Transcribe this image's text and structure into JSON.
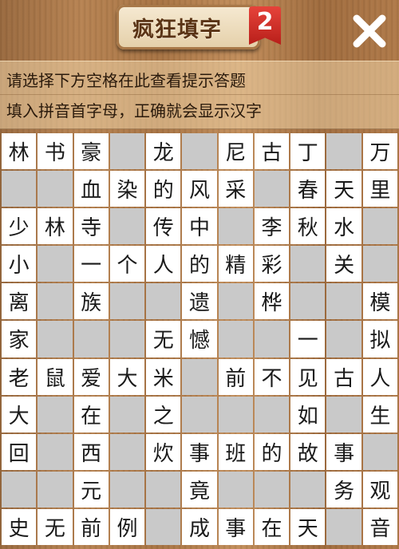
{
  "header": {
    "title": "疯狂填字",
    "badge": "2",
    "close_glyph": "✕"
  },
  "hint": {
    "line1": "请选择下方空格在此查看提示答题",
    "line2": "填入拼音首字母，正确就会显示汉字"
  },
  "colors": {
    "cell_filled": "#ffffff",
    "cell_blocked": "#c9c9c9",
    "badge": "#d63028",
    "title_text": "#5a3416"
  },
  "grid": {
    "rows": 11,
    "cols": 11,
    "block_marker": "#",
    "cells": [
      [
        "林",
        "书",
        "豪",
        "#",
        "龙",
        "#",
        "尼",
        "古",
        "丁",
        "#",
        "万"
      ],
      [
        "#",
        "#",
        "血",
        "染",
        "的",
        "风",
        "采",
        "#",
        "春",
        "天",
        "里"
      ],
      [
        "少",
        "林",
        "寺",
        "#",
        "传",
        "中",
        "#",
        "李",
        "秋",
        "水",
        "#"
      ],
      [
        "小",
        "#",
        "一",
        "个",
        "人",
        "的",
        "精",
        "彩",
        "#",
        "关",
        "#"
      ],
      [
        "离",
        "#",
        "族",
        "#",
        "#",
        "遗",
        "#",
        "桦",
        "#",
        "#",
        "模"
      ],
      [
        "家",
        "#",
        "#",
        "#",
        "无",
        "憾",
        "#",
        "#",
        "一",
        "#",
        "拟"
      ],
      [
        "老",
        "鼠",
        "爱",
        "大",
        "米",
        "#",
        "前",
        "不",
        "见",
        "古",
        "人"
      ],
      [
        "大",
        "#",
        "在",
        "#",
        "之",
        "#",
        "#",
        "#",
        "如",
        "#",
        "生"
      ],
      [
        "回",
        "#",
        "西",
        "#",
        "炊",
        "事",
        "班",
        "的",
        "故",
        "事",
        "#"
      ],
      [
        "#",
        "#",
        "元",
        "#",
        "#",
        "竟",
        "#",
        "#",
        "#",
        "务",
        "观"
      ],
      [
        "史",
        "无",
        "前",
        "例",
        "#",
        "成",
        "事",
        "在",
        "天",
        "#",
        "音"
      ]
    ]
  }
}
